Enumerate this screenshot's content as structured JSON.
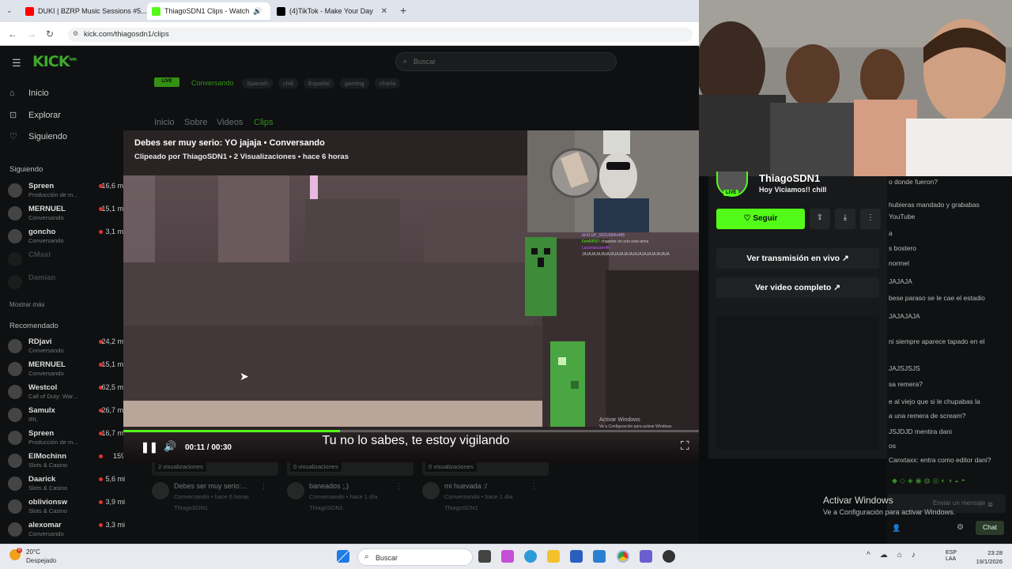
{
  "browser": {
    "tabs": [
      {
        "title": "DUKI | BZRP Music Sessions #5...",
        "color": "#ff0000"
      },
      {
        "title": "ThiagoSDN1 Clips - Watch",
        "color": "#53fc18"
      },
      {
        "title": "(4)TikTok - Make Your Day",
        "color": "#000000"
      }
    ],
    "new_tab": "+",
    "url": "kick.com/thiagosdn1/clips"
  },
  "kick": {
    "logo": "KICK",
    "logo_sup": "beta",
    "search_placeholder": "Buscar",
    "nav": [
      {
        "label": "Inicio",
        "icon": "home-icon"
      },
      {
        "label": "Explorar",
        "icon": "compass-icon"
      },
      {
        "label": "Siguiendo",
        "icon": "heart-icon"
      }
    ],
    "following_title": "Siguiendo",
    "following": [
      {
        "name": "Spreen",
        "category": "Producción de m...",
        "viewers": "16,6 mi"
      },
      {
        "name": "MERNUEL",
        "category": "Conversando",
        "viewers": "15,1 mi"
      },
      {
        "name": "goncho",
        "category": "Conversando",
        "viewers": "3,1 mi"
      },
      {
        "name": "CMaxi",
        "category": "",
        "viewers": ""
      },
      {
        "name": "Damian",
        "category": "",
        "viewers": ""
      }
    ],
    "show_more": "Mostrar más",
    "recommended_title": "Recomendado",
    "recommended": [
      {
        "name": "RDjavi",
        "category": "Conversando",
        "viewers": "24,2 mi"
      },
      {
        "name": "MERNUEL",
        "category": "Conversando",
        "viewers": "15,1 mi"
      },
      {
        "name": "Westcol",
        "category": "Call of Duty: War...",
        "viewers": "62,5 mi"
      },
      {
        "name": "Samulx",
        "category": "IRL",
        "viewers": "26,7 mi"
      },
      {
        "name": "Spreen",
        "category": "Producción de m...",
        "viewers": "16,7 mi"
      },
      {
        "name": "ElMochinn",
        "category": "Slots & Casino",
        "viewers": "159"
      },
      {
        "name": "Daarick",
        "category": "Slots & Casino",
        "viewers": "5,6 mi"
      },
      {
        "name": "oblivionsw",
        "category": "Slots & Casino",
        "viewers": "3,9 mi"
      },
      {
        "name": "alexomar",
        "category": "Conversando",
        "viewers": "3,3 mi"
      }
    ],
    "channel_live": "LIVE",
    "channel_category": "Conversando",
    "tags": [
      "Spanish",
      "chill",
      "Español",
      "gaming",
      "charla"
    ],
    "profile_tabs": [
      "Inicio",
      "Sobre",
      "Videos",
      "Clips"
    ],
    "active_tab": "Clips"
  },
  "player": {
    "title": "Debes ser muy serio: YO jajaja • Conversando",
    "subtitle": "Clipeado por ThiagoSDN1 • 2 Visualizaciones • hace 6 horas",
    "caption": "Tu no lo sabes, te estoy vigilando",
    "time": "00:11 / 00:30",
    "progress": 0.37,
    "watermark_1": "Activar Windows",
    "watermark_2": "Ve a Configuración para activar Windows.",
    "overlay_chat": [
      {
        "user": "di-KLUP_SDZv5BAx485",
        "text": "",
        "color": "#c6a0ff"
      },
      {
        "user": "FerrRP97",
        "text": ": chapeter en orto este tema",
        "color": "#53fc18"
      },
      {
        "user": "Lucaniasusenfik",
        "text": "",
        "color": "#c056ff"
      },
      {
        "user": "",
        "text": "JAJAJAJAJAJAJAJAJAJAJAJAJAJAJAJAJAJAJA",
        "color": "#ffffff"
      }
    ]
  },
  "clips": [
    {
      "views": "2 visualizaciones",
      "title": "Debes ser muy serio:...",
      "meta": "Conversando • hace 6 horas",
      "user": "ThiagoSDN1"
    },
    {
      "views": "0 visualizaciones",
      "title": "baneados ;,)",
      "meta": "Conversando • hace 1 día",
      "user": "ThiagoSDN1"
    },
    {
      "views": "0 visualizaciones",
      "title": "mi huevada :/",
      "meta": "Conversando • hace 1 día",
      "user": "ThiagoSDN1"
    }
  ],
  "channel": {
    "name": "ThiagoSDN1",
    "stream_title": "Hoy Viciamos!! chill",
    "live": "LIVE",
    "follow": "Seguir",
    "watch_live": "Ver transmisión en vivo",
    "full_video": "Ver video completo"
  },
  "chat": {
    "lines": [
      "o donde fueron?",
      "hubieras mandado y grababas",
      "YouTube",
      "a",
      "s bostero",
      "normel",
      "JAJAJA",
      "bese paraso se le cae el estadio",
      "JAJAJAJA",
      "ni siempre aparece tapado en el",
      "JAJSJSJS",
      "sa remera?",
      "e al viejo que si le chupabas la",
      "a una remera de scream?",
      "JSJDJD mentira dani",
      "os",
      "Canxtaxx: entra como editor dani?"
    ],
    "input_placeholder": "Enviar un mensaje",
    "viewers": "0",
    "send": "Chat",
    "activate_1": "Activar Windows",
    "activate_2": "Ve a Configuración para activar Windows."
  },
  "taskbar": {
    "temp": "20°C",
    "weather": "Despejado",
    "badge": "8",
    "search": "Buscar",
    "lang_1": "ESP",
    "lang_2": "LAA",
    "time": "23:28",
    "date": "19/1/2026"
  }
}
